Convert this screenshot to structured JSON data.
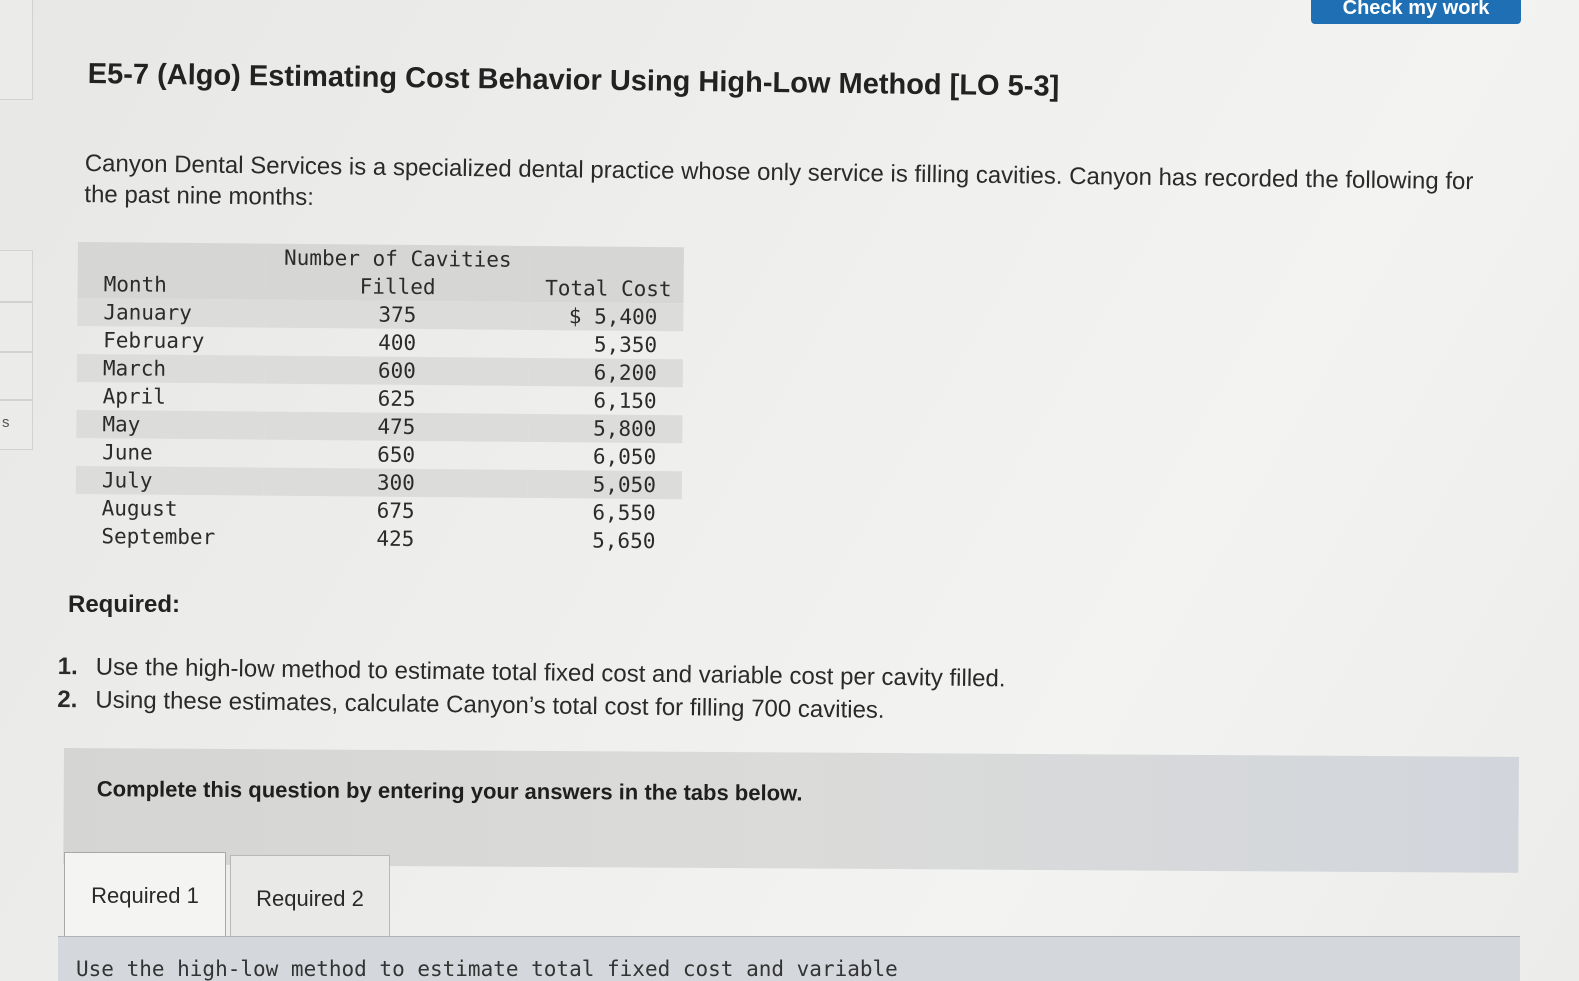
{
  "header": {
    "top_button_label": "Check my work"
  },
  "title": "E5-7 (Algo) Estimating Cost Behavior Using High-Low Method [LO 5-3]",
  "intro": "Canyon Dental Services is a specialized dental practice whose only service is filling cavities. Canyon has recorded the following for the past nine months:",
  "table": {
    "headers": {
      "month": "Month",
      "cavities_line1": "Number of Cavities",
      "cavities_line2": "Filled",
      "cost": "Total Cost"
    },
    "rows": [
      {
        "month": "January",
        "cavities": "375",
        "cost": "$ 5,400"
      },
      {
        "month": "February",
        "cavities": "400",
        "cost": "5,350"
      },
      {
        "month": "March",
        "cavities": "600",
        "cost": "6,200"
      },
      {
        "month": "April",
        "cavities": "625",
        "cost": "6,150"
      },
      {
        "month": "May",
        "cavities": "475",
        "cost": "5,800"
      },
      {
        "month": "June",
        "cavities": "650",
        "cost": "6,050"
      },
      {
        "month": "July",
        "cavities": "300",
        "cost": "5,050"
      },
      {
        "month": "August",
        "cavities": "675",
        "cost": "6,550"
      },
      {
        "month": "September",
        "cavities": "425",
        "cost": "5,650"
      }
    ]
  },
  "required": {
    "label": "Required:",
    "items": [
      {
        "num": "1.",
        "text": "Use the high-low method to estimate total fixed cost and variable cost per cavity filled."
      },
      {
        "num": "2.",
        "text": "Using these estimates, calculate Canyon’s total cost for filling 700 cavities."
      }
    ]
  },
  "instruction": "Complete this question by entering your answers in the tabs below.",
  "tabs": [
    {
      "label": "Required 1",
      "active": true
    },
    {
      "label": "Required 2",
      "active": false
    }
  ],
  "tab_content_partial": "Use the high-low method to estimate total fixed cost and variable",
  "left_rail_letter": "s"
}
